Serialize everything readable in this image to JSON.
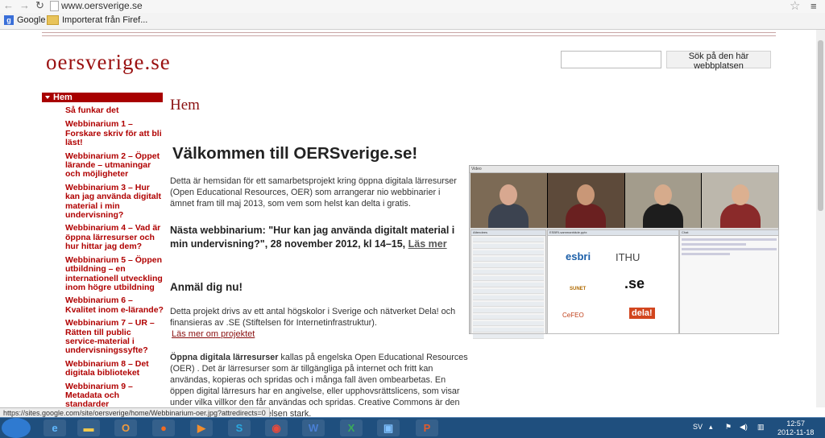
{
  "browser": {
    "url": "www.oersverige.se",
    "bookmarks": [
      {
        "label": "Google",
        "icon": "google-icon"
      },
      {
        "label": "Importerat från Firef...",
        "icon": "folder-icon"
      }
    ]
  },
  "site": {
    "title": "oersverige.se",
    "search_button": "Sök på den här webbplatsen",
    "search_value": ""
  },
  "sidebar": {
    "active": "Hem",
    "items": [
      "Så funkar det",
      "Webbinarium 1 – Forskare skriv för att bli läst!",
      "Webbinarium 2 – Öppet lärande – utmaningar och möjligheter",
      "Webbinarium 3 – Hur kan jag använda digitalt material i min undervisning?",
      "Webbinarium 4 – Vad är öppna lärresurser och hur hittar jag dem?",
      "Webbinarium 5 – Öppen utbildning – en internationell utveckling inom högre utbildning",
      "Webbinarium 6 – Kvalitet inom e-lärande?",
      "Webbinarium 7 – UR – Rätten till public service-material i undervisningssyfte?",
      "Webbinarium 8 – Det digitala biblioteket",
      "Webbinarium 9 – Metadata och standarder"
    ]
  },
  "main": {
    "page_heading": "Hem",
    "welcome": "Välkommen till OERSverige.se!",
    "intro": "Detta är hemsidan för ett samarbetsprojekt kring öppna digitala lärresurser (Open Educational Resources, OER) som arrangerar nio webbinarier i ämnet fram till maj 2013, som vem som helst kan delta i gratis.",
    "next_text": "Nästa webbinarium: \"Hur kan jag använda digitalt material i min undervisning?\",  28 november 2012, kl 14–15,",
    "next_link": "Läs mer",
    "signup": "Anmäl dig nu!",
    "partners": "Detta projekt drivs av ett antal högskolor i Sverige och nätverket Dela! och finansieras av .SE (Stiftelsen för Internetinfrastruktur).",
    "more_link": "Läs mer om projektet",
    "oer_bold": "Öppna digitala lärresurser",
    "oer_text": " kallas på engelska Open Educational Resources (OER) . Det är lärresurser som är tillgängliga på internet och fritt kan användas, kopieras och spridas och i många fall även ombearbetas. En öppen digital lärresurs har en angivelse, eller upphovsrättslicens, som visar under vilka villkor den får användas och spridas. Creative Commons är den internationellt är OER-rörelsen stark."
  },
  "video_panel": {
    "bar_label": "Video",
    "panels": {
      "attendees": "Attendees",
      "slides": "ESBRI-sammanträde.pptx",
      "chat": "Chat"
    },
    "logos": [
      "esbri",
      "ITHU",
      "SUNET",
      ".se",
      "CeFEO",
      "dela!"
    ]
  },
  "status_bar": "https://sites.google.com/site/oersverige/home/Webbinarium-oer.jpg?attredirects=0",
  "taskbar": {
    "language": "SV",
    "time": "12:57",
    "date": "2012-11-18"
  },
  "colors": {
    "brand_red": "#9a1010",
    "sidebar_active": "#a80000",
    "taskbar": "#1f4f7e"
  }
}
